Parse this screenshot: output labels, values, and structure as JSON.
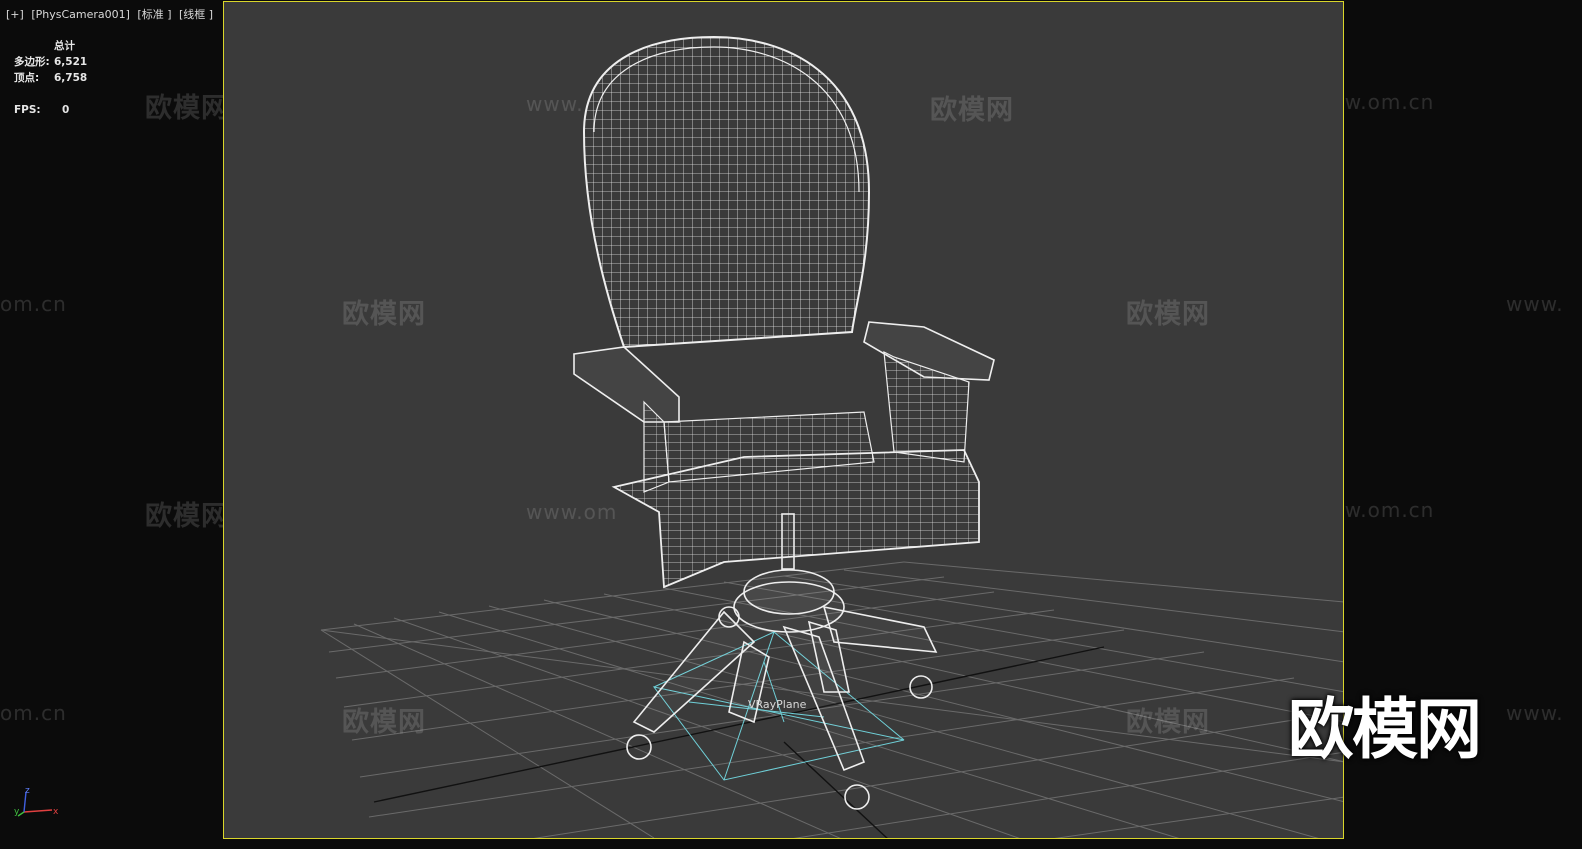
{
  "viewport": {
    "menu_label": "[+]",
    "camera_label": "[PhysCamera001]",
    "shading_label": "[标准 ]",
    "mode_label": "[线框 ]"
  },
  "stats": {
    "header": "总计",
    "polygons_label": "多边形:",
    "polygons_value": "6,521",
    "vertices_label": "顶点:",
    "vertices_value": "6,758",
    "fps_label": "FPS:",
    "fps_value": "0"
  },
  "scene": {
    "object_label": "VRayPlane",
    "wireframe_color": "#e8e8e8",
    "selection_color": "#6fd0d8",
    "viewport_border_color": "#d9d62a"
  },
  "watermarks": {
    "logo_text": "欧模网",
    "url_text": "www.om.cn",
    "url_left_partial": "om.cn",
    "url_right_partial": "www.",
    "url_mid_partial": "www.om"
  },
  "axis": {
    "x": "x",
    "y": "y",
    "z": "z"
  }
}
